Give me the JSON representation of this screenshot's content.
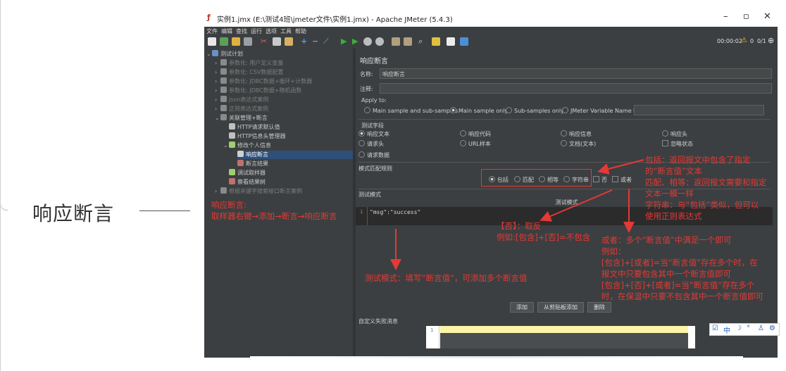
{
  "outline": {
    "title": "响应断言"
  },
  "window": {
    "title": "实例1.jmx (E:\\测试4班\\jmeter文件\\实例1.jmx) - Apache JMeter (5.4.3)",
    "menu": [
      "文件",
      "编辑",
      "查找",
      "运行",
      "选项",
      "工具",
      "帮助"
    ],
    "timer": "00:00:02",
    "warn_count": "0",
    "threads": "0/1"
  },
  "tree": {
    "root": "测试计划",
    "items": [
      "参数化: 用户定义变量",
      "参数化: CSV数据配置",
      "参数化: JDBC数据+循环+计数器",
      "参数化: JDBC数据+随机函数",
      "json表达式案例",
      "正则表达式案例",
      "关联管理+断言",
      "HTTP请求默认值",
      "HTTP信息头管理器",
      "修改个人信息",
      "响应断言",
      "断言结果",
      "调试取样器",
      "察看结果树",
      "根据关键字搜索接口断言案例"
    ]
  },
  "panel": {
    "heading": "响应断言",
    "name_label": "名称:",
    "name_value": "响应断言",
    "comment_label": "注释:",
    "apply_to": "Apply to:",
    "apply_options": [
      "Main sample and sub-samples",
      "Main sample only",
      "Sub-samples only",
      "JMeter Variable Name to use"
    ],
    "test_field_label": "测试字段",
    "test_fields": [
      "响应文本",
      "响应代码",
      "响应信息",
      "响应头",
      "请求头",
      "URL样本",
      "文档(文本)",
      "忽略状态",
      "请求数据"
    ],
    "match_rule_label": "模式匹配规则",
    "match_rules": [
      "包括",
      "匹配",
      "相等",
      "字符串",
      "否",
      "或者"
    ],
    "pattern_label": "测试模式",
    "pattern_header": "测试模式",
    "pattern_line_no": "1",
    "pattern_value": "\"msg\":\"success\"",
    "buttons": [
      "添加",
      "从剪贴板添加",
      "删除"
    ],
    "custom_fail_label": "自定义失败消息",
    "custom_line_no": "1"
  },
  "annotations": {
    "left": [
      "响应断言:",
      "取样器右键→添加→断言→响应断言"
    ],
    "include": [
      "包括：返回报文中包含了指定",
      "的“断言值”文本",
      "匹配、相等：返回报文需要和指定",
      "文本一模一样",
      "字符串：与“包括”类似，但可以",
      "使用正则表达式"
    ],
    "not": [
      "【否】：取反",
      "例如:[包含]+[否]=不包含"
    ],
    "or": [
      "或者：多个“断言值”中满足一个即可",
      "例如：",
      "[包含]+[或者]=当“断言值”存在多个时，在",
      "报文中只要包含其中一个断言值即可",
      "[包含]+[否]+[或者]=当“断言值”存在多个",
      "时，在保温中只要不包含其中一个断言值即可"
    ],
    "mode": "测试模式：填写“断言值”，可添加多个断言值"
  },
  "ime": {
    "label": "中"
  }
}
